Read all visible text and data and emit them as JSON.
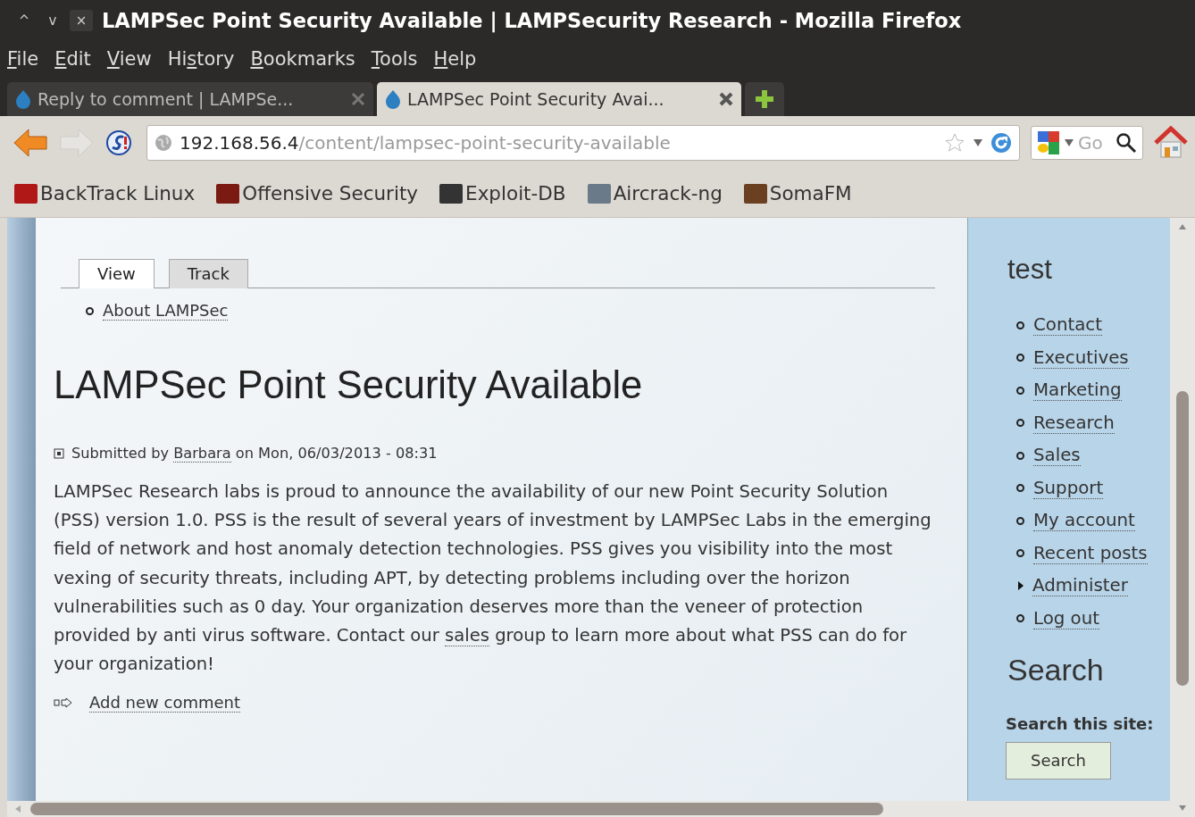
{
  "window": {
    "title": "LAMPSec Point Security Available | LAMPSecurity Research - Mozilla Firefox",
    "controls": [
      "^",
      "v",
      "×"
    ]
  },
  "menu": [
    {
      "key": "F",
      "after": "ile"
    },
    {
      "key": "E",
      "after": "dit"
    },
    {
      "key": "V",
      "after": "iew"
    },
    {
      "before": "Hi",
      "key": "s",
      "after": "tory"
    },
    {
      "key": "B",
      "after": "ookmarks"
    },
    {
      "key": "T",
      "after": "ools"
    },
    {
      "key": "H",
      "after": "elp"
    }
  ],
  "tabs": [
    {
      "label": "Reply to comment | LAMPSe...",
      "selected": false
    },
    {
      "label": "LAMPSec Point Security Avai...",
      "selected": true
    }
  ],
  "address": {
    "host": "192.168.56.4",
    "path": "/content/lampsec-point-security-available"
  },
  "search_engine": {
    "value": "Go"
  },
  "bookmarks": [
    {
      "label": "BackTrack Linux",
      "color": "#b01818"
    },
    {
      "label": "Offensive Security",
      "color": "#7a1a12"
    },
    {
      "label": "Exploit-DB",
      "color": "#333333"
    },
    {
      "label": "Aircrack-ng",
      "color": "#6a7a88"
    },
    {
      "label": "SomaFM",
      "color": "#6b4020"
    }
  ],
  "page": {
    "tabs": [
      {
        "label": "View",
        "selected": true
      },
      {
        "label": "Track",
        "selected": false
      }
    ],
    "breadcrumb": [
      "About LAMPSec"
    ],
    "title": "LAMPSec Point Security Available",
    "submitted": {
      "before": "Submitted by",
      "author": "Barbara",
      "after": "on Mon, 06/03/2013 - 08:31"
    },
    "body": {
      "before": "LAMPSec Research labs is proud to announce the availability of our new Point Security Solution (PSS) version 1.0. PSS is the result of several years of investment by LAMPSec Labs in the emerging field of network and host anomaly detection technologies. PSS gives you visibility into the most vexing of security threats, including APT, by detecting problems including over the horizon vulnerabilities such as 0 day. Your organization deserves more than the veneer of protection provided by anti virus software. Contact our",
      "link": "sales",
      "after": "group to learn more about what PSS can do for your organization!"
    },
    "comment_link": "Add new comment"
  },
  "sidebar": {
    "title": "test",
    "items": [
      {
        "label": "Contact",
        "kind": "leaf"
      },
      {
        "label": "Executives",
        "kind": "leaf"
      },
      {
        "label": "Marketing",
        "kind": "leaf"
      },
      {
        "label": "Research",
        "kind": "leaf"
      },
      {
        "label": "Sales",
        "kind": "leaf"
      },
      {
        "label": "Support",
        "kind": "leaf"
      },
      {
        "label": "My account",
        "kind": "leaf"
      },
      {
        "label": "Recent posts",
        "kind": "leaf"
      },
      {
        "label": "Administer",
        "kind": "collapsed"
      },
      {
        "label": "Log out",
        "kind": "leaf"
      }
    ],
    "search_title": "Search",
    "search_label": "Search this site:",
    "search_button": "Search"
  }
}
